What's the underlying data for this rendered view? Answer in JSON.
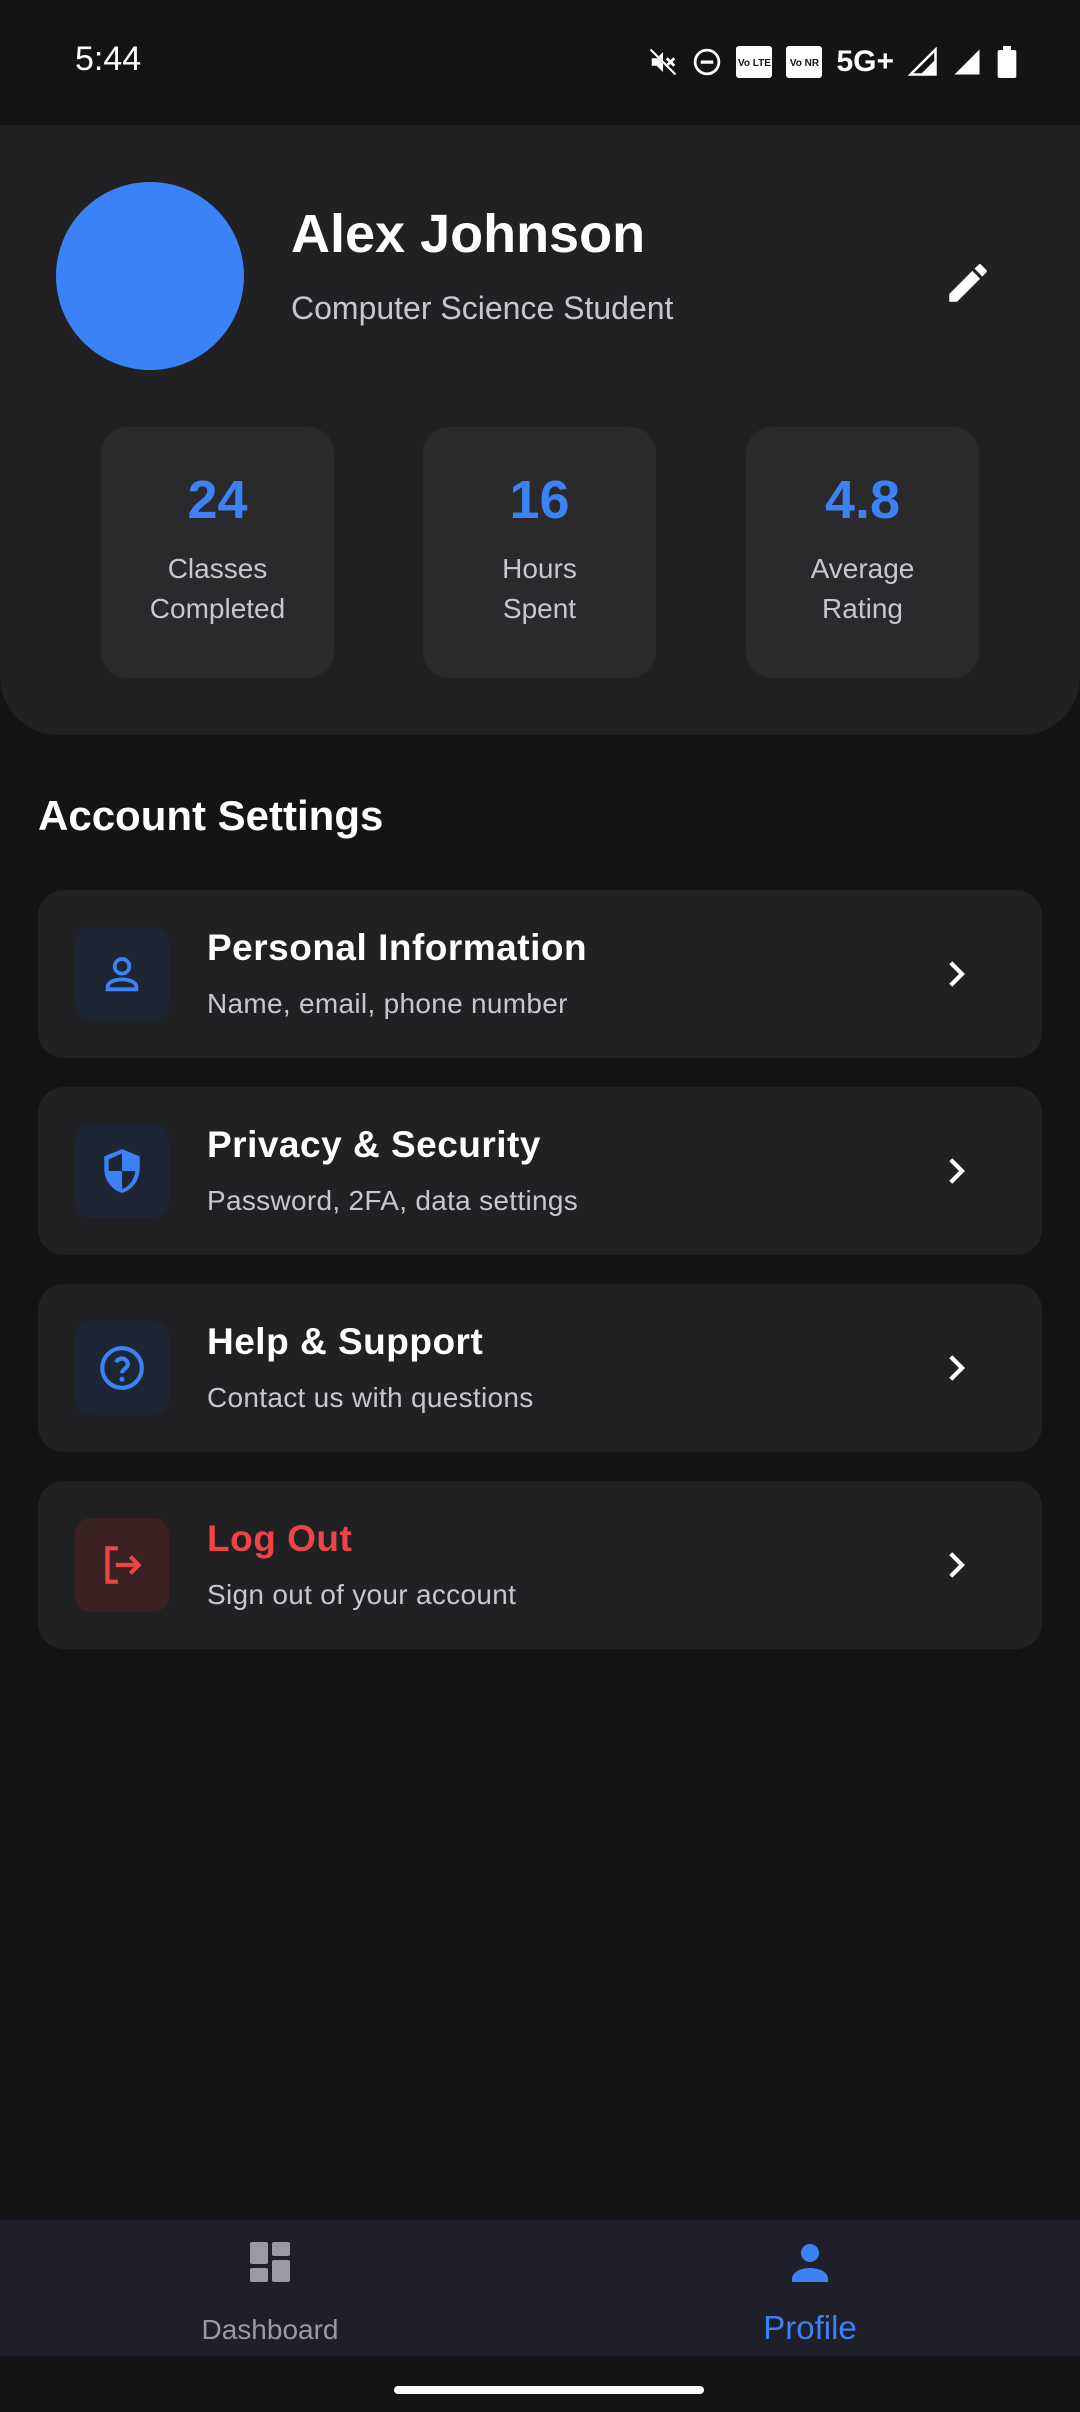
{
  "status_bar": {
    "time": "5:44",
    "network": "5G+",
    "vo1": "Vo LTE",
    "vo2": "Vo NR"
  },
  "profile": {
    "name": "Alex Johnson",
    "role": "Computer Science Student",
    "avatar_color": "#3b82f6"
  },
  "stats": [
    {
      "value": "24",
      "label": "Classes Completed"
    },
    {
      "value": "16",
      "label": "Hours Spent"
    },
    {
      "value": "4.8",
      "label": "Average Rating"
    }
  ],
  "section_title": "Account Settings",
  "settings": [
    {
      "icon": "person-icon",
      "title": "Personal Information",
      "subtitle": "Name, email, phone number"
    },
    {
      "icon": "shield-icon",
      "title": "Privacy & Security",
      "subtitle": "Password, 2FA, data settings"
    },
    {
      "icon": "help-icon",
      "title": "Help & Support",
      "subtitle": "Contact us with questions"
    },
    {
      "icon": "logout-icon",
      "title": "Log Out",
      "subtitle": "Sign out of your account"
    }
  ],
  "nav": {
    "items": [
      {
        "icon": "dashboard-icon",
        "label": "Dashboard"
      },
      {
        "icon": "profile-icon",
        "label": "Profile"
      }
    ],
    "active": "Profile"
  },
  "colors": {
    "accent": "#3b82f6",
    "danger": "#ef4444",
    "background": "#141415",
    "card": "#212123"
  }
}
